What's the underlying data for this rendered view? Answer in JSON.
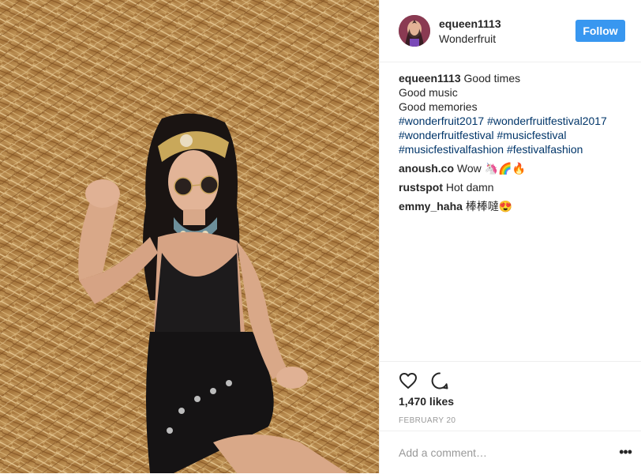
{
  "post": {
    "username": "equeen1113",
    "location": "Wonderfruit",
    "follow_label": "Follow",
    "caption": {
      "username": "equeen1113",
      "lines": [
        "Good times",
        "Good music",
        "Good memories"
      ],
      "hashtags": [
        "#wonderfruit2017",
        "#wonderfruitfestival2017",
        "#wonderfruitfestival",
        "#musicfestival",
        "#musicfestivalfashion",
        "#festivalfashion"
      ]
    },
    "comments": [
      {
        "username": "anoush.co",
        "text": "Wow 🦄🌈🔥"
      },
      {
        "username": "rustspot",
        "text": "Hot damn"
      },
      {
        "username": "emmy_haha",
        "text": "棒棒噠😍"
      }
    ],
    "likes": "1,470 likes",
    "date": "FEBRUARY 20",
    "add_comment_placeholder": "Add a comment…",
    "more_label": "•••"
  },
  "icons": {
    "like": "heart-icon",
    "comment": "comment-bubble-icon",
    "more": "more-options-icon"
  },
  "colors": {
    "follow_button": "#3897f0",
    "hashtag": "#003569",
    "straw": "#c49a5a"
  }
}
